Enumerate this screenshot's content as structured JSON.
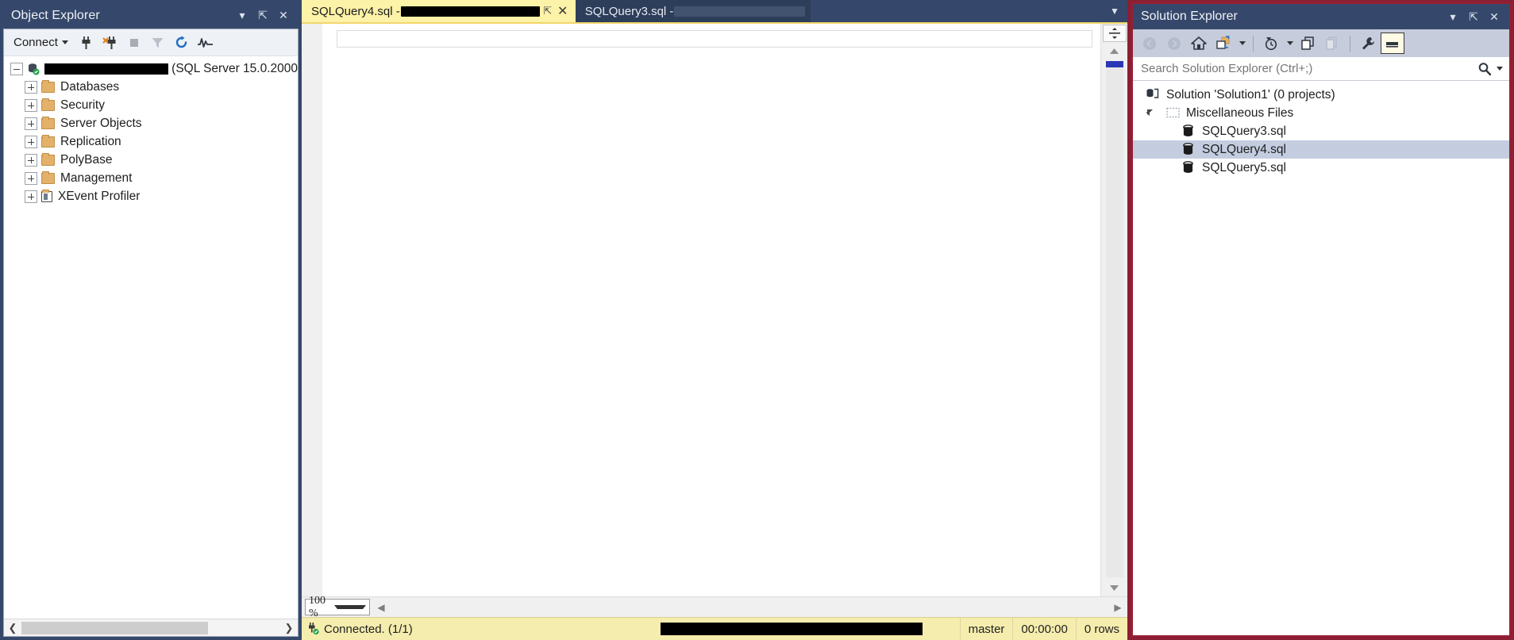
{
  "object_explorer": {
    "title": "Object Explorer",
    "header_buttons": [
      {
        "name": "window-dropdown",
        "glyph": "▾"
      },
      {
        "name": "pin",
        "glyph": "⇱"
      },
      {
        "name": "close",
        "glyph": "✕"
      }
    ],
    "toolbar": {
      "connect_label": "Connect",
      "icons": [
        "connect-icon",
        "disconnect-icon",
        "stop-icon",
        "filter-icon",
        "refresh-icon",
        "activity-monitor-icon"
      ]
    },
    "tree": [
      {
        "label": "(SQL Server 15.0.2000",
        "redacted_prefix": true,
        "icon": "server-icon",
        "expander": "minus",
        "level": 0
      },
      {
        "label": "Databases",
        "icon": "folder-icon",
        "expander": "plus",
        "level": 1
      },
      {
        "label": "Security",
        "icon": "folder-icon",
        "expander": "plus",
        "level": 1
      },
      {
        "label": "Server Objects",
        "icon": "folder-icon",
        "expander": "plus",
        "level": 1
      },
      {
        "label": "Replication",
        "icon": "folder-icon",
        "expander": "plus",
        "level": 1
      },
      {
        "label": "PolyBase",
        "icon": "folder-icon",
        "expander": "plus",
        "level": 1
      },
      {
        "label": "Management",
        "icon": "folder-icon",
        "expander": "plus",
        "level": 1
      },
      {
        "label": "XEvent Profiler",
        "icon": "xevent-icon",
        "expander": "plus",
        "level": 1
      }
    ]
  },
  "editor": {
    "tabs": [
      {
        "prefix": "SQLQuery4.sql - ",
        "redacted": true,
        "active": true,
        "pin": "⇱",
        "close": "✕"
      },
      {
        "prefix": "SQLQuery3.sql - ",
        "redacted": true,
        "active": false
      }
    ],
    "zoom_level": "100 %",
    "status": {
      "connected": "Connected. (1/1)",
      "server_redacted": true,
      "database": "master",
      "elapsed": "00:00:00",
      "rows": "0 rows"
    }
  },
  "solution_explorer": {
    "title": "Solution Explorer",
    "header_buttons": [
      {
        "name": "window-dropdown",
        "glyph": "▾"
      },
      {
        "name": "pin",
        "glyph": "⇱"
      },
      {
        "name": "close",
        "glyph": "✕"
      }
    ],
    "toolbar_icons": [
      "back-icon",
      "forward-icon",
      "home-icon",
      "sync-with-active-document-icon",
      "pending-changes-icon",
      "show-all-files-icon",
      "collapse-all-icon",
      "properties-wrench-icon",
      "preview-selected-items-icon"
    ],
    "search_placeholder": "Search Solution Explorer (Ctrl+;)",
    "tree": [
      {
        "label": "Solution 'Solution1' (0 projects)",
        "icon": "solution-icon",
        "level": 0,
        "selected": false
      },
      {
        "label": "Miscellaneous Files",
        "icon": "misc-files-icon",
        "level": 1,
        "selected": false,
        "expander": "open"
      },
      {
        "label": "SQLQuery3.sql",
        "icon": "sql-file-icon",
        "level": 2,
        "selected": false
      },
      {
        "label": "SQLQuery4.sql",
        "icon": "sql-file-icon",
        "level": 2,
        "selected": true
      },
      {
        "label": "SQLQuery5.sql",
        "icon": "sql-file-icon",
        "level": 2,
        "selected": false
      }
    ]
  },
  "colors": {
    "chrome": "#35486b",
    "active_tab": "#fcf2a8",
    "status_bar": "#f5edae",
    "focus_border": "#9a1f33",
    "selection": "#c4cde0"
  }
}
